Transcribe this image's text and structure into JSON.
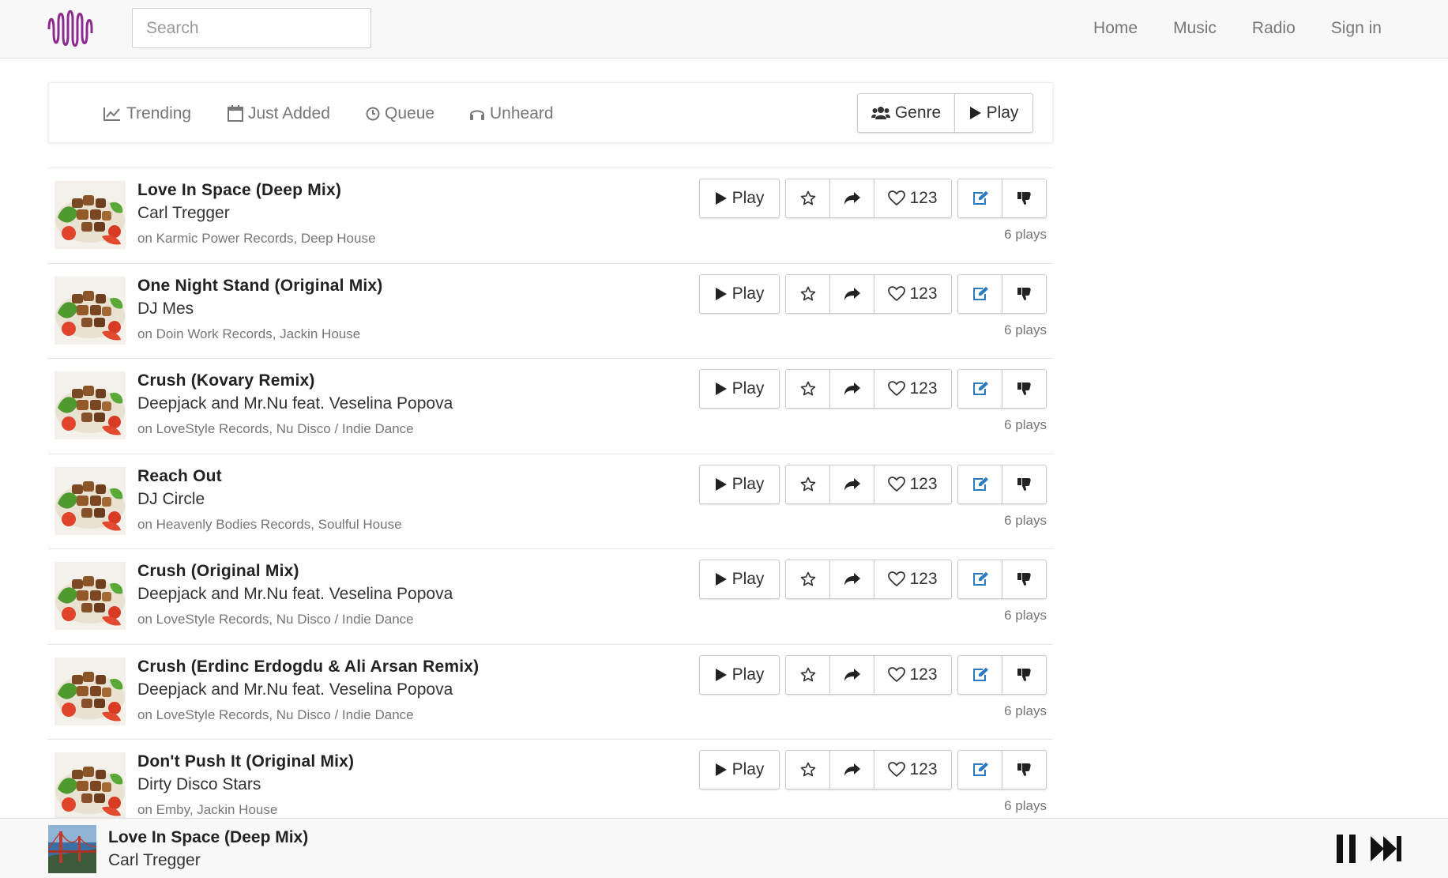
{
  "search": {
    "placeholder": "Search"
  },
  "nav": [
    "Home",
    "Music",
    "Radio",
    "Sign in"
  ],
  "filters": {
    "tabs": [
      "Trending",
      "Just Added",
      "Queue",
      "Unheard"
    ],
    "genre_label": "Genre",
    "play_label": "Play"
  },
  "tracks": [
    {
      "title": "Love In Space (Deep Mix)",
      "artist": "Carl Tregger",
      "label": "on Karmic Power Records, Deep House",
      "likes": "123",
      "plays": "6 plays",
      "play_label": "Play"
    },
    {
      "title": "One Night Stand (Original Mix)",
      "artist": "DJ Mes",
      "label": "on Doin Work Records, Jackin House",
      "likes": "123",
      "plays": "6 plays",
      "play_label": "Play"
    },
    {
      "title": "Crush (Kovary Remix)",
      "artist": "Deepjack and Mr.Nu feat. Veselina Popova",
      "label": "on LoveStyle Records, Nu Disco / Indie Dance",
      "likes": "123",
      "plays": "6 plays",
      "play_label": "Play"
    },
    {
      "title": "Reach Out",
      "artist": "DJ Circle",
      "label": "on Heavenly Bodies Records, Soulful House",
      "likes": "123",
      "plays": "6 plays",
      "play_label": "Play"
    },
    {
      "title": "Crush (Original Mix)",
      "artist": "Deepjack and Mr.Nu feat. Veselina Popova",
      "label": "on LoveStyle Records, Nu Disco / Indie Dance",
      "likes": "123",
      "plays": "6 plays",
      "play_label": "Play"
    },
    {
      "title": "Crush (Erdinc Erdogdu & Ali Arsan Remix)",
      "artist": "Deepjack and Mr.Nu feat. Veselina Popova",
      "label": "on LoveStyle Records, Nu Disco / Indie Dance",
      "likes": "123",
      "plays": "6 plays",
      "play_label": "Play"
    },
    {
      "title": "Don't Push It (Original Mix)",
      "artist": "Dirty Disco Stars",
      "label": "on Emby, Jackin House",
      "likes": "123",
      "plays": "6 plays",
      "play_label": "Play"
    }
  ],
  "player": {
    "title": "Love In Space (Deep Mix)",
    "artist": "Carl Tregger"
  },
  "colors": {
    "logo": "#8e2a8e",
    "edit_icon": "#2a7ac4",
    "navbar_bg": "#f8f8f8"
  },
  "icons": [
    "logo-waveform-icon",
    "trending-icon",
    "calendar-icon",
    "clock-icon",
    "headphones-icon",
    "users-icon",
    "play-icon",
    "star-icon",
    "share-icon",
    "heart-icon",
    "edit-icon",
    "thumbs-down-icon",
    "pause-icon",
    "next-icon"
  ]
}
